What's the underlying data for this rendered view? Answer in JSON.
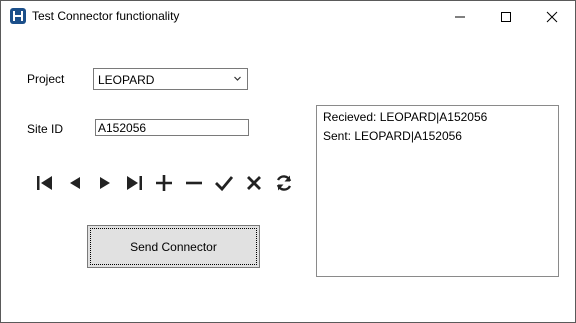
{
  "window": {
    "title": "Test Connector functionality",
    "icon": "app-logo-icon",
    "controls": [
      "minimize-icon",
      "maximize-icon",
      "close-icon"
    ]
  },
  "form": {
    "project_label": "Project",
    "project_value": "LEOPARD",
    "site_id_label": "Site ID",
    "site_id_value": "A152056"
  },
  "navigator": {
    "buttons": [
      "first-icon",
      "previous-icon",
      "next-icon",
      "last-icon",
      "add-icon",
      "delete-icon",
      "confirm-icon",
      "cancel-icon",
      "refresh-icon"
    ]
  },
  "send_button_label": "Send Connector",
  "log": {
    "lines": [
      "Recieved: LEOPARD|A152056",
      "Sent: LEOPARD|A152056"
    ]
  }
}
